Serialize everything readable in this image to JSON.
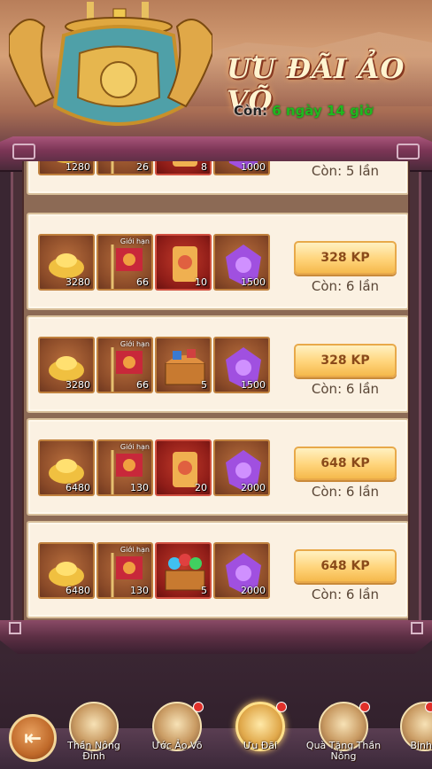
{
  "header": {
    "title": "ƯU ĐÃI ẢO VÕ",
    "remaining_label": "Còn:",
    "remaining_value": "6 ngày 14 giờ"
  },
  "limit_tag": "Giới hạn",
  "rows": [
    {
      "qty": [
        "1280",
        "26",
        "8",
        "1000"
      ],
      "price": "",
      "remaining": "Còn: 5 lần"
    },
    {
      "qty": [
        "3280",
        "66",
        "10",
        "1500"
      ],
      "price": "328 KP",
      "remaining": "Còn: 6 lần"
    },
    {
      "qty": [
        "3280",
        "66",
        "5",
        "1500"
      ],
      "price": "328 KP",
      "remaining": "Còn: 6 lần"
    },
    {
      "qty": [
        "6480",
        "130",
        "20",
        "2000"
      ],
      "price": "648 KP",
      "remaining": "Còn: 6 lần"
    },
    {
      "qty": [
        "6480",
        "130",
        "5",
        "2000"
      ],
      "price": "648 KP",
      "remaining": "Còn: 6 lần"
    }
  ],
  "nav": {
    "items": [
      {
        "label": "Thần Nông Đỉnh"
      },
      {
        "label": "Ước Ảo Võ"
      },
      {
        "label": "Ưu Đãi"
      },
      {
        "label": "Quà Tặng Thần Nông"
      },
      {
        "label": "Binh"
      }
    ]
  },
  "colors": {
    "accent_green": "#1fb81f",
    "button_gold": "#ffd47a",
    "frame_purple": "#7d3657"
  }
}
